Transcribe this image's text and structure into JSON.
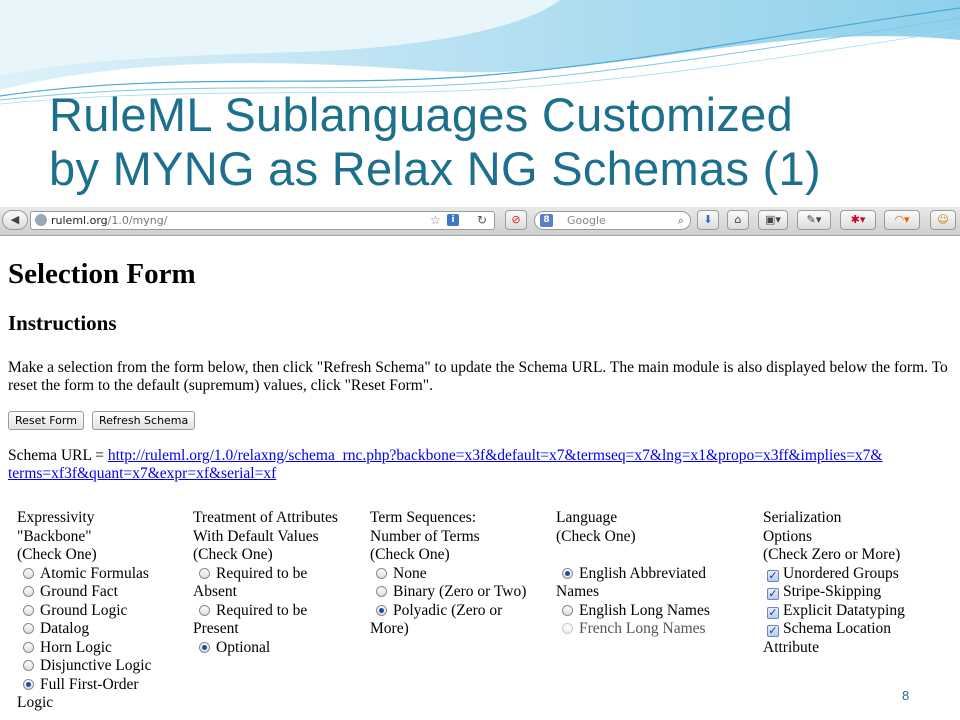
{
  "slide": {
    "title_line1": "RuleML Sublanguages Customized",
    "title_line2": "by MYNG as Relax NG Schemas (1)",
    "page_number": "8"
  },
  "browser": {
    "url_host": "ruleml.org",
    "url_path": "/1.0/myng/",
    "search_placeholder": "Google",
    "icons": [
      "back-icon",
      "globe-icon",
      "star-icon",
      "info-icon",
      "reload-icon",
      "stop-icon",
      "google-icon",
      "search-icon",
      "download-icon",
      "home-icon"
    ]
  },
  "page": {
    "heading": "Selection Form",
    "subheading": "Instructions",
    "instructions": "Make a selection from the form below, then click \"Refresh Schema\" to update the Schema URL. The main module is also displayed below the form. To reset the form to the default (supremum) values, click \"Reset Form\".",
    "reset_label": "Reset Form",
    "refresh_label": "Refresh Schema",
    "schema_label": "Schema URL = ",
    "schema_url_line1": "http://ruleml.org/1.0/relaxng/schema_rnc.php?backbone=x3f&default=x7&termseq=x7&lng=x1&propo=x3ff&implies=x7&",
    "schema_url_line2": "terms=xf3f&quant=x7&expr=xf&serial=xf"
  },
  "form": {
    "expressivity": {
      "head1": "Expressivity",
      "head2": "\"Backbone\"",
      "head3": "(Check One)",
      "options": [
        "Atomic Formulas",
        "Ground Fact",
        "Ground Logic",
        "Datalog",
        "Horn Logic",
        "Disjunctive Logic",
        "Full First-Order"
      ],
      "last_wrap": "Logic",
      "selected": "Full First-Order"
    },
    "default_values": {
      "head1": "Treatment of Attributes",
      "head2": "With Default Values",
      "head3": "(Check One)",
      "opt1": "Required to be",
      "opt1_wrap": "Absent",
      "opt2": "Required to be",
      "opt2_wrap": "Present",
      "opt3": "Optional",
      "selected": "Optional"
    },
    "term_sequences": {
      "head1": "Term Sequences:",
      "head2": "Number of Terms",
      "head3": "(Check One)",
      "opt1": "None",
      "opt2": "Binary (Zero or Two)",
      "opt3": "Polyadic (Zero or",
      "opt3_wrap": "More)",
      "selected": "Polyadic (Zero or More)"
    },
    "language": {
      "head1": "Language",
      "head2": "(Check One)",
      "opt1": "English Abbreviated",
      "opt1_wrap": "Names",
      "opt2": "English Long Names",
      "opt3": "French Long Names",
      "selected": "English Abbreviated Names"
    },
    "serialization": {
      "head1": "Serialization",
      "head2": "Options",
      "head3": "(Check Zero or More)",
      "opt1": "Unordered Groups",
      "opt2": "Stripe-Skipping",
      "opt3": "Explicit Datatyping",
      "opt4": "Schema Location",
      "opt4_wrap": "Attribute",
      "checked": [
        "Unordered Groups",
        "Stripe-Skipping",
        "Explicit Datatyping",
        "Schema Location Attribute"
      ]
    }
  },
  "colors": {
    "title": "#1d6f8e",
    "link": "#0000ee",
    "wave": "#6fc3e6"
  }
}
